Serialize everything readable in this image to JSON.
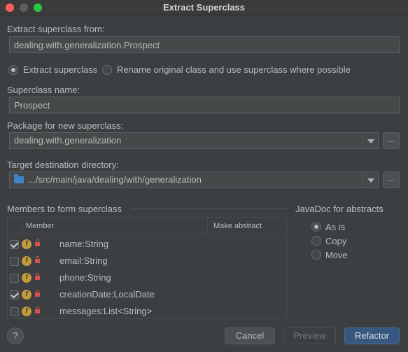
{
  "window": {
    "title": "Extract Superclass"
  },
  "extract_from": {
    "label": "Extract superclass from:",
    "value": "dealing.with.generalization.Prospect"
  },
  "mode": {
    "options": [
      {
        "label": "Extract superclass",
        "selected": true
      },
      {
        "label": "Rename original class and use superclass where possible",
        "selected": false
      }
    ]
  },
  "superclass_name": {
    "label": "Superclass name:",
    "value": "Prospect"
  },
  "package": {
    "label": "Package for new superclass:",
    "value": "dealing.with.generalization",
    "browse": "..."
  },
  "target_dir": {
    "label": "Target destination directory:",
    "value": ".../src/main/java/dealing/with/generalization",
    "browse": "..."
  },
  "members": {
    "label": "Members to form superclass",
    "columns": [
      "Member",
      "Make abstract"
    ],
    "rows": [
      {
        "name": "name:String",
        "checked": true
      },
      {
        "name": "email:String",
        "checked": false
      },
      {
        "name": "phone:String",
        "checked": false
      },
      {
        "name": "creationDate:LocalDate",
        "checked": true
      },
      {
        "name": "messages:List<String>",
        "checked": false
      }
    ]
  },
  "javadoc": {
    "label": "JavaDoc for abstracts",
    "options": [
      {
        "label": "As is",
        "selected": true
      },
      {
        "label": "Copy",
        "selected": false
      },
      {
        "label": "Move",
        "selected": false
      }
    ]
  },
  "buttons": {
    "help": "?",
    "cancel": "Cancel",
    "preview": "Preview",
    "refactor": "Refactor"
  },
  "colors": {
    "background": "#3c3f41",
    "field": "#45494a",
    "accent": "#365880",
    "field_icon": "#c49b3b",
    "lock": "#d9524f"
  }
}
